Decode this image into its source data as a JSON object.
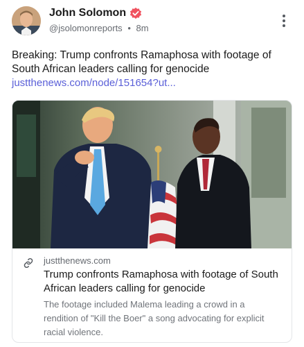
{
  "author": {
    "name": "John Solomon",
    "handle": "@jsolomonreports",
    "separator": "•",
    "time": "8m",
    "avatar_icon": "avatar-photo",
    "verified_icon": "verified-badge-icon",
    "verified_color": "#f0525f"
  },
  "menu_icon": "more-vertical-icon",
  "post": {
    "text": "Breaking: Trump confronts Ramaphosa with footage of South African leaders calling for genocide",
    "link": "justthenews.com/node/151654?ut..."
  },
  "card": {
    "image_icon": "article-photo",
    "link_icon": "link-icon",
    "domain": "justthenews.com",
    "title": "Trump confronts Ramaphosa with footage of South African leaders calling for genocide",
    "description": "The footage included Malema leading a crowd in a rendition of \"Kill the Boer\" a song advocating for explicit racial violence."
  },
  "colors": {
    "link": "#5a5fd8",
    "text": "#1a1a1a",
    "muted": "#666a70",
    "border": "#e3e5e8"
  }
}
